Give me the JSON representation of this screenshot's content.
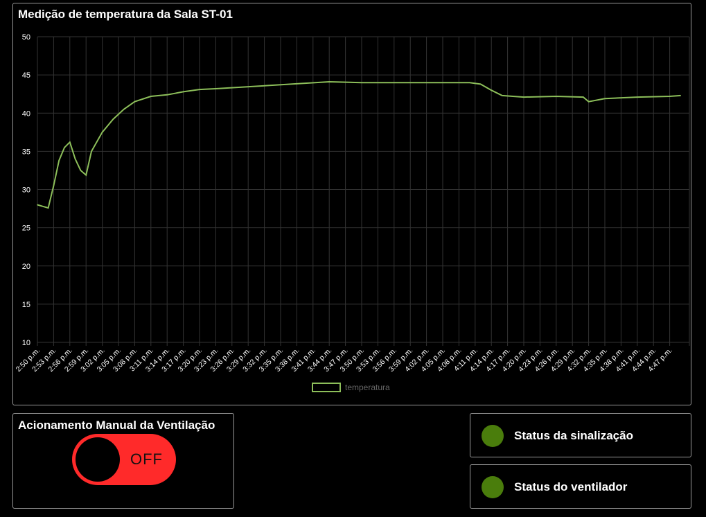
{
  "chart_panel": {
    "title": "Medição de temperatura da Sala ST-01"
  },
  "manual_panel": {
    "title": "Acionamento Manual da Ventilação",
    "toggle_state": "OFF",
    "toggle_color": "#ff2a2a"
  },
  "status": [
    {
      "label": "Status da sinalização",
      "led_color": "#4a7d0c"
    },
    {
      "label": "Status do ventilador",
      "led_color": "#4a7d0c"
    }
  ],
  "chart_data": {
    "type": "line",
    "title": "Medição de temperatura da Sala ST-01",
    "ylim": [
      10,
      50
    ],
    "yticks": [
      10,
      15,
      20,
      25,
      30,
      35,
      40,
      45,
      50
    ],
    "categories": [
      "2:50 p.m.",
      "2:53 p.m.",
      "2:56 p.m.",
      "2:59 p.m.",
      "3:02 p.m.",
      "3:05 p.m.",
      "3:08 p.m.",
      "3:11 p.m.",
      "3:14 p.m.",
      "3:17 p.m.",
      "3:20 p.m.",
      "3:23 p.m.",
      "3:26 p.m.",
      "3:29 p.m.",
      "3:32 p.m.",
      "3:35 p.m.",
      "3:38 p.m.",
      "3:41 p.m.",
      "3:44 p.m.",
      "3:47 p.m.",
      "3:50 p.m.",
      "3:53 p.m.",
      "3:56 p.m.",
      "3:59 p.m.",
      "4:02 p.m.",
      "4:05 p.m.",
      "4:08 p.m.",
      "4:11 p.m.",
      "4:14 p.m.",
      "4:17 p.m.",
      "4:20 p.m.",
      "4:23 p.m.",
      "4:26 p.m.",
      "4:29 p.m.",
      "4:32 p.m.",
      "4:35 p.m.",
      "4:38 p.m.",
      "4:41 p.m.",
      "4:44 p.m.",
      "4:47 p.m."
    ],
    "grid": true,
    "legend_position": "bottom",
    "series": [
      {
        "name": "temperatura",
        "color": "#8dbf5a",
        "x": [
          "2:50 p.m.",
          "2:51 p.m.",
          "2:52 p.m.",
          "2:53 p.m.",
          "2:54 p.m.",
          "2:55 p.m.",
          "2:56 p.m.",
          "2:57 p.m.",
          "2:58 p.m.",
          "2:59 p.m.",
          "3:00 p.m.",
          "3:02 p.m.",
          "3:04 p.m.",
          "3:06 p.m.",
          "3:08 p.m.",
          "3:11 p.m.",
          "3:14 p.m.",
          "3:17 p.m.",
          "3:20 p.m.",
          "3:23 p.m.",
          "3:44 p.m.",
          "3:50 p.m.",
          "4:00 p.m.",
          "4:10 p.m.",
          "4:12 p.m.",
          "4:14 p.m.",
          "4:16 p.m.",
          "4:20 p.m.",
          "4:26 p.m.",
          "4:31 p.m.",
          "4:32 p.m.",
          "4:35 p.m.",
          "4:41 p.m.",
          "4:47 p.m.",
          "4:49 p.m."
        ],
        "values": [
          28.0,
          27.8,
          27.6,
          30.5,
          33.8,
          35.5,
          36.2,
          34.0,
          32.5,
          31.9,
          35.0,
          37.5,
          39.2,
          40.5,
          41.5,
          42.2,
          42.4,
          42.8,
          43.1,
          43.2,
          44.1,
          44.0,
          44.0,
          44.0,
          43.8,
          43.0,
          42.3,
          42.1,
          42.2,
          42.1,
          41.5,
          41.9,
          42.1,
          42.2,
          42.3
        ]
      }
    ]
  }
}
